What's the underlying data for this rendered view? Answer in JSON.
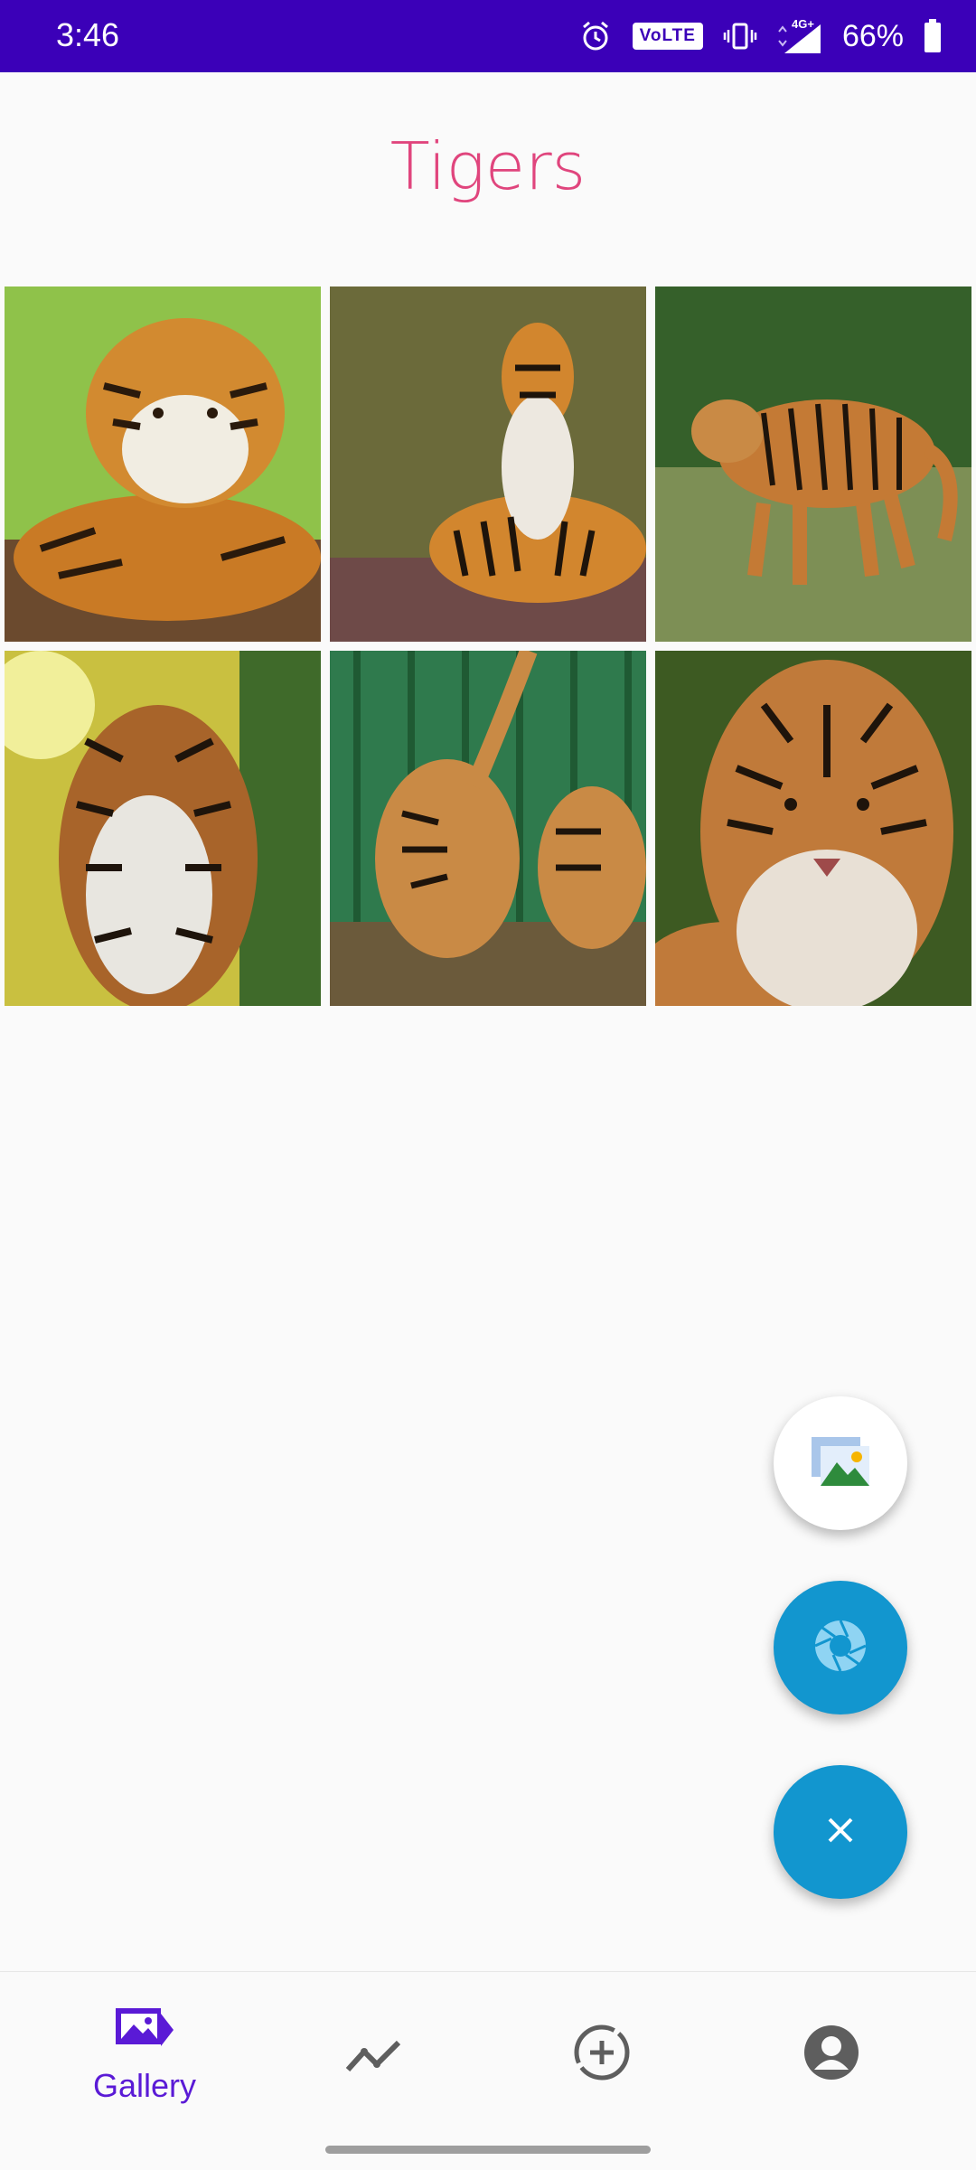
{
  "status_bar": {
    "time": "3:46",
    "volte": "VoLTE",
    "network": "4G+",
    "battery": "66%",
    "icons": [
      "alarm-icon",
      "vibrate-icon",
      "signal-icon",
      "battery-icon"
    ]
  },
  "page": {
    "title": "Tigers"
  },
  "gallery": {
    "images": [
      {
        "name": "tiger-photo-1",
        "palette": [
          "#8fc24a",
          "#c97a25",
          "#2a1a0c"
        ]
      },
      {
        "name": "tiger-photo-2",
        "palette": [
          "#6b6a3a",
          "#d2862e",
          "#6e4a48"
        ]
      },
      {
        "name": "tiger-photo-3",
        "palette": [
          "#35602a",
          "#c47a35",
          "#7d8f55"
        ]
      },
      {
        "name": "tiger-photo-4",
        "palette": [
          "#c9c040",
          "#a8642a",
          "#3f6a2a"
        ]
      },
      {
        "name": "tiger-photo-5",
        "palette": [
          "#2f7a4d",
          "#c98a45",
          "#6b5a3b"
        ]
      },
      {
        "name": "tiger-photo-6",
        "palette": [
          "#3d5a22",
          "#c07a3a",
          "#e8e0d5"
        ]
      }
    ]
  },
  "fabs": {
    "gallery_icon": "gallery-icon",
    "camera_icon": "camera-aperture-icon",
    "close_icon": "close-icon"
  },
  "bottom_nav": {
    "items": [
      {
        "label": "Gallery",
        "icon": "gallery-icon",
        "active": true
      },
      {
        "label": "",
        "icon": "trending-icon",
        "active": false
      },
      {
        "label": "",
        "icon": "add-circle-icon",
        "active": false
      },
      {
        "label": "",
        "icon": "account-icon",
        "active": false
      }
    ],
    "active_color": "#5a1ad6"
  },
  "colors": {
    "status_bar": "#3b00b8",
    "title": "#e0457d",
    "fab": "#1296cf"
  }
}
